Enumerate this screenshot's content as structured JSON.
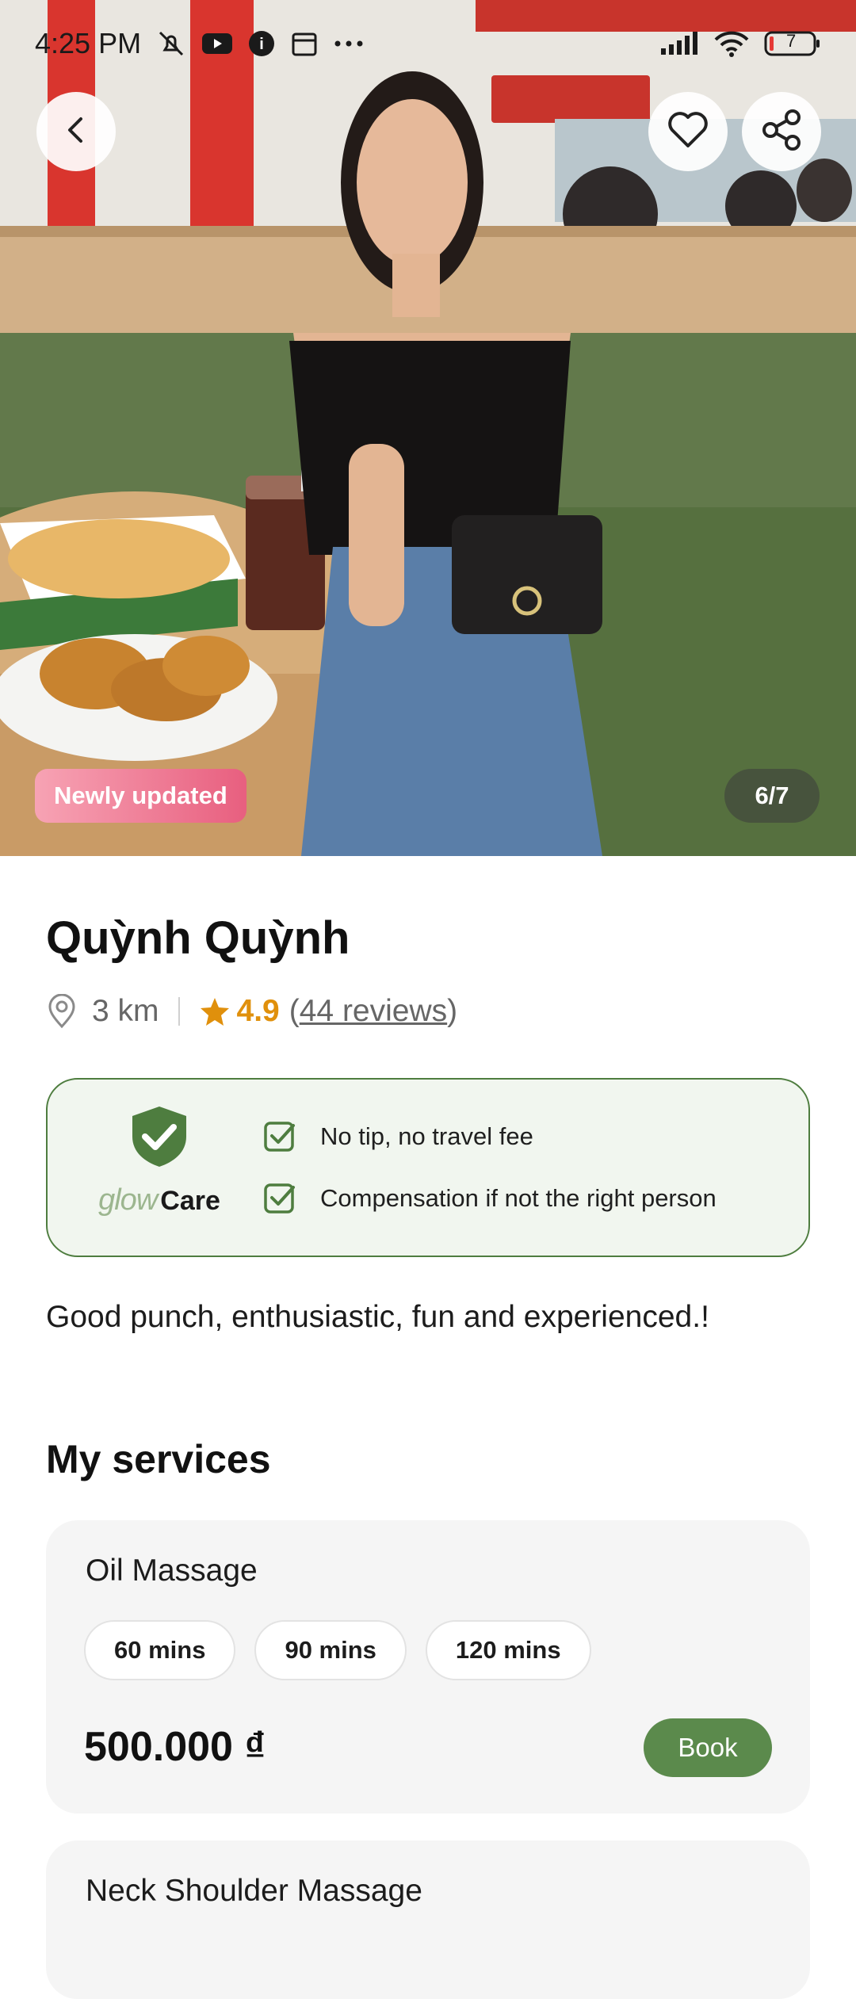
{
  "status_bar": {
    "time": "4:25 PM",
    "battery": "7"
  },
  "gallery": {
    "badge": "Newly updated",
    "counter": "6/7"
  },
  "profile": {
    "name": "Quỳnh Quỳnh",
    "distance": "3 km",
    "rating": "4.9",
    "reviews_open": "(",
    "reviews": "44 reviews",
    "reviews_close": ")"
  },
  "care": {
    "brand_glow": "glow",
    "brand_care": "Care",
    "features": [
      "No tip, no travel fee",
      "Compensation if not the right person"
    ],
    "accent": "#4e7d3f"
  },
  "bio": "Good punch, enthusiastic, fun and experienced.!",
  "services_title": "My services",
  "services": [
    {
      "name": "Oil Massage",
      "durations": [
        "60 mins",
        "90 mins",
        "120 mins"
      ],
      "price": "500.000 ₫",
      "book_label": "Book"
    },
    {
      "name": "Neck Shoulder Massage"
    }
  ],
  "icons": {
    "back": "chevron-left-icon",
    "favorite": "heart-icon",
    "share": "share-icon",
    "location": "location-pin-icon",
    "rating": "star-icon",
    "care": "shield-check-icon",
    "feature": "checkbox-icon"
  },
  "colors": {
    "primary": "#5b8a4c",
    "rating": "#e0900c",
    "badge_start": "#f7a3b4",
    "badge_end": "#e85f7f"
  }
}
